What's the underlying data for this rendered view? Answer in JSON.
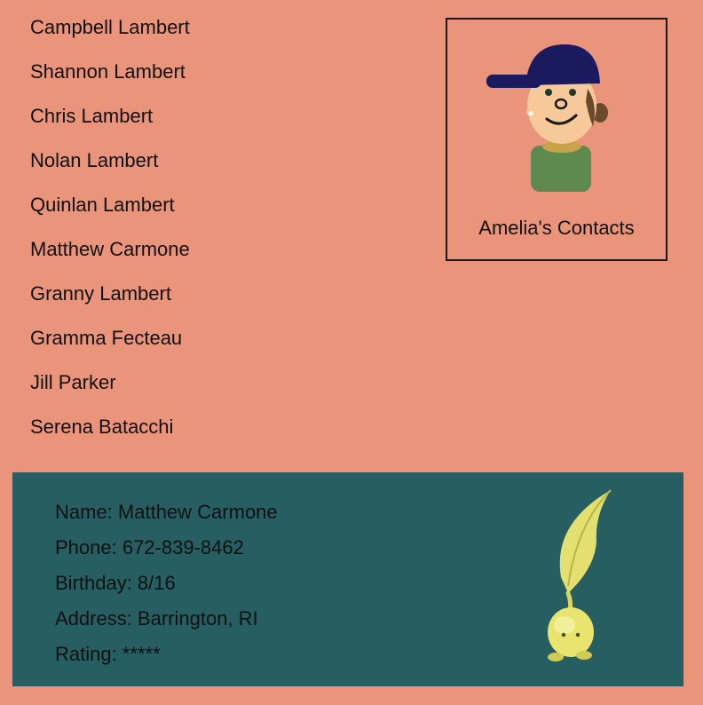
{
  "contacts": [
    {
      "name": "Campbell Lambert"
    },
    {
      "name": "Shannon Lambert"
    },
    {
      "name": "Chris Lambert"
    },
    {
      "name": "Nolan Lambert"
    },
    {
      "name": "Quinlan Lambert"
    },
    {
      "name": "Matthew Carmone"
    },
    {
      "name": "Granny Lambert"
    },
    {
      "name": "Gramma Fecteau"
    },
    {
      "name": "Jill Parker"
    },
    {
      "name": "Serena Batacchi"
    }
  ],
  "profile": {
    "title": "Amelia's Contacts",
    "avatar_icon": "user-avatar-cap-icon"
  },
  "selected_contact": {
    "name_line": "Name: Matthew Carmone",
    "phone_line": "Phone: 672-839-8462",
    "birthday_line": "Birthday: 8/16",
    "address_line": "Address: Barrington, RI",
    "rating_line": "Rating: *****",
    "creature_icon": "leaf-sprout-creature-icon"
  },
  "colors": {
    "background": "#EA947B",
    "detail_panel": "#275E62",
    "text": "#111111",
    "cap": "#1C1A5E",
    "skin": "#F7C99A",
    "shirt": "#5E8A50",
    "sprout": "#E3E070"
  }
}
